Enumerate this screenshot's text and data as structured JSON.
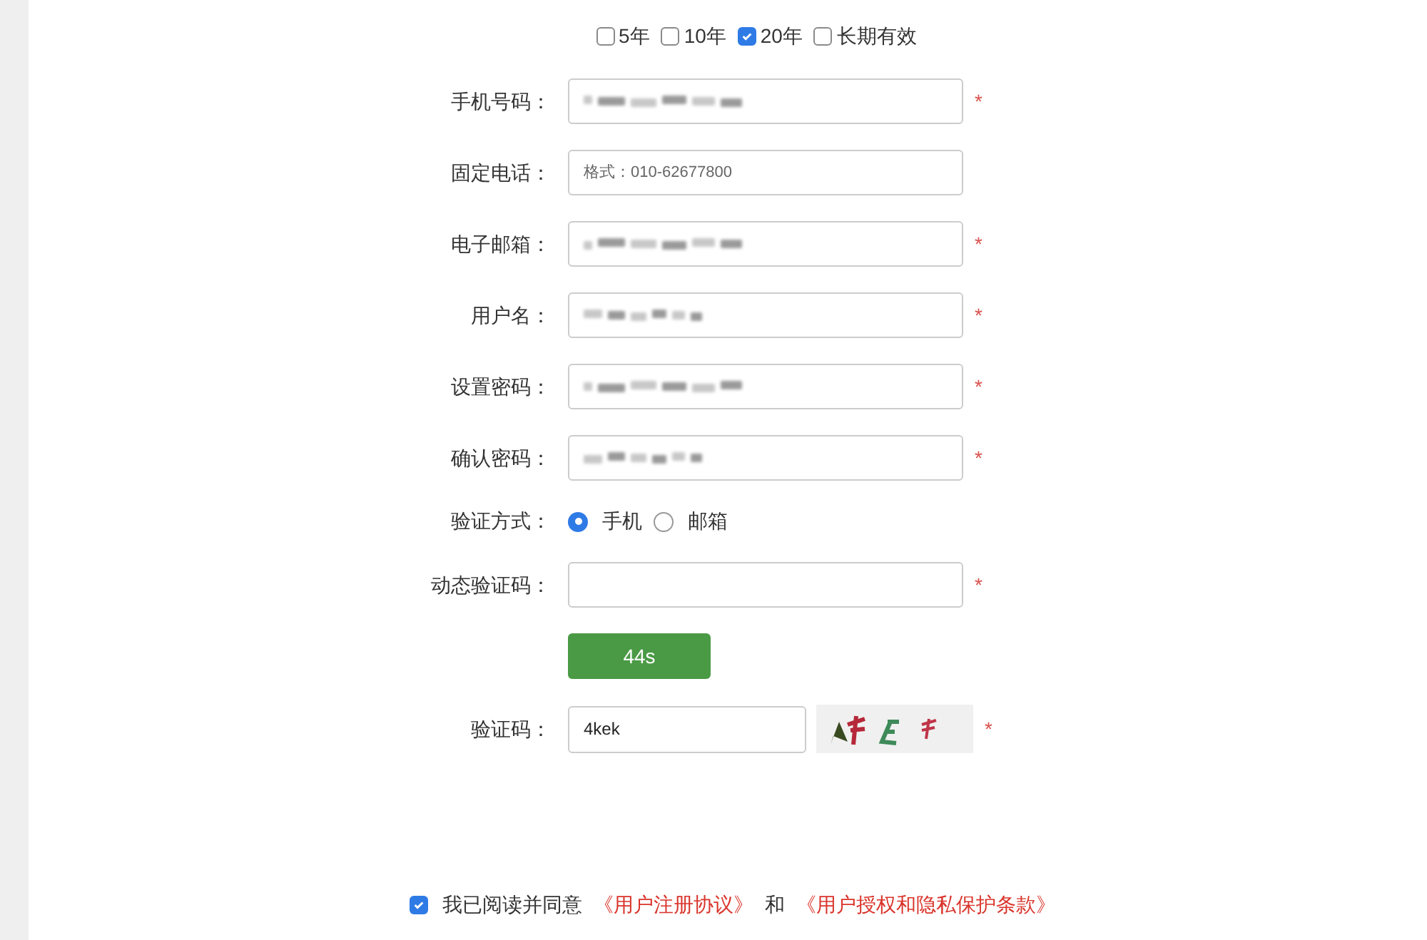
{
  "validity_options": [
    {
      "label": "5年",
      "checked": false
    },
    {
      "label": "10年",
      "checked": false
    },
    {
      "label": "20年",
      "checked": true
    },
    {
      "label": "长期有效",
      "checked": false
    }
  ],
  "fields": [
    {
      "kind": "text",
      "label": "手机号码：",
      "blurred": true,
      "required": true
    },
    {
      "kind": "text",
      "label": "固定电话：",
      "placeholder": "格式：010-62677800",
      "blurred": false,
      "required": false
    },
    {
      "kind": "text",
      "label": "电子邮箱：",
      "blurred": true,
      "required": true
    },
    {
      "kind": "text",
      "label": "用户名：",
      "blurred": true,
      "required": true
    },
    {
      "kind": "text",
      "label": "设置密码：",
      "blurred": true,
      "required": true
    },
    {
      "kind": "text",
      "label": "确认密码：",
      "blurred": true,
      "required": true
    },
    {
      "kind": "radio",
      "label": "验证方式：",
      "options": [
        {
          "label": "手机",
          "selected": true
        },
        {
          "label": "邮箱",
          "selected": false
        }
      ]
    },
    {
      "kind": "text",
      "label": "动态验证码：",
      "blurred": false,
      "required": true
    },
    {
      "kind": "button",
      "label": "44s"
    },
    {
      "kind": "captcha",
      "label": "验证码：",
      "value": "4kek",
      "required": true
    }
  ],
  "required_mark": "*",
  "agreement": {
    "checked": true,
    "text": "我已阅读并同意",
    "link_1": "《用户注册协议》",
    "joiner": "和",
    "link_2": "《用户授权和隐私保护条款》"
  }
}
